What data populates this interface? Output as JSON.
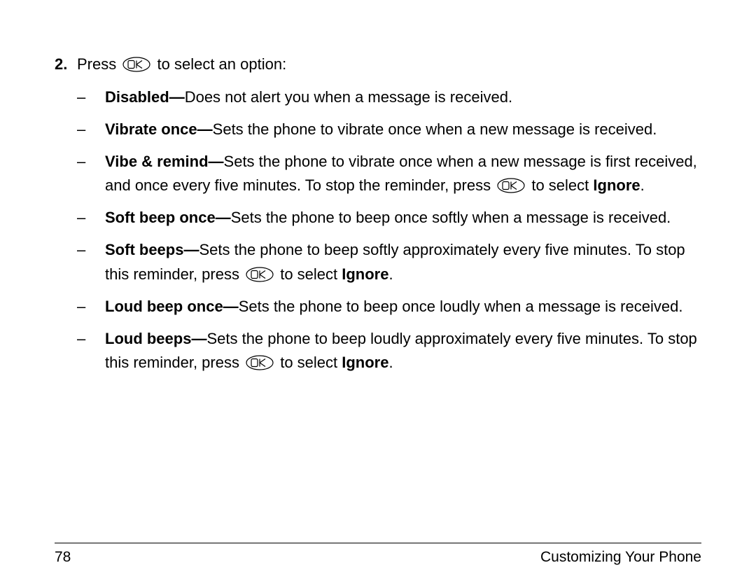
{
  "step": {
    "number": "2.",
    "lead_pre": "Press",
    "lead_post": " to select an option:"
  },
  "items": [
    {
      "title": "Disabled—",
      "desc": "Does not alert you when a message is received."
    },
    {
      "title": "Vibrate once—",
      "desc": "Sets the phone to vibrate once when a new message is received."
    },
    {
      "title": "Vibe & remind—",
      "pre": "Sets the phone to vibrate once when a new message is first received, and once every five minutes. To stop the reminder, press",
      "post": " to select ",
      "tail": "Ignore",
      "period": "."
    },
    {
      "title": "Soft beep once—",
      "desc": "Sets the phone to beep once softly when a message is received."
    },
    {
      "title": "Soft beeps—",
      "pre": "Sets the phone to beep softly approximately every five minutes. To stop this reminder, press",
      "post": " to select ",
      "tail": "Ignore",
      "period": "."
    },
    {
      "title": "Loud beep once—",
      "desc": "Sets the phone to beep once loudly when a message is received."
    },
    {
      "title": "Loud beeps—",
      "pre": "Sets the phone to beep loudly approximately every five minutes. To stop this reminder, press",
      "post": " to select ",
      "tail": "Ignore",
      "period": "."
    }
  ],
  "dash": "–",
  "footer": {
    "page": "78",
    "title": "Customizing Your Phone"
  },
  "icon": {
    "name": "ok-button"
  }
}
